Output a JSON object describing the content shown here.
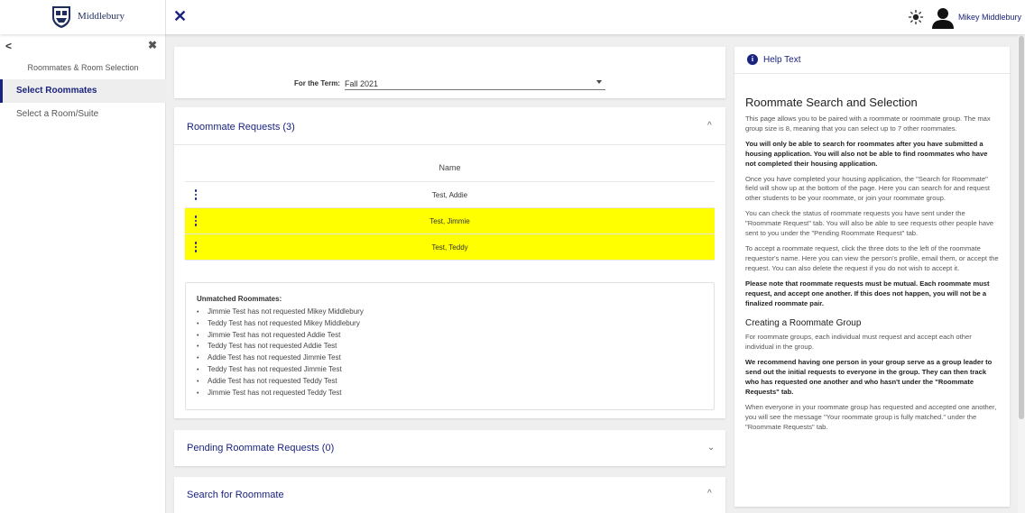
{
  "app": {
    "brand_name": "Middlebury",
    "user_name": "Mikey Middlebury"
  },
  "sidebar": {
    "heading": "Roommates & Room Selection",
    "items": [
      {
        "label": "Select Roommates",
        "active": true
      },
      {
        "label": "Select a Room/Suite",
        "active": false
      }
    ]
  },
  "term": {
    "label": "For the Term:",
    "value": "Fall 2021"
  },
  "roommate_requests": {
    "title": "Roommate Requests (3)",
    "column_header": "Name",
    "rows": [
      {
        "name": "Test, Addie",
        "highlighted": false
      },
      {
        "name": "Test, Jimmie",
        "highlighted": true
      },
      {
        "name": "Test, Teddy",
        "highlighted": true
      }
    ],
    "unmatched_title": "Unmatched Roommates:",
    "unmatched": [
      "Jimmie Test has not requested Mikey Middlebury",
      "Teddy Test has not requested Mikey Middlebury",
      "Jimmie Test has not requested Addie Test",
      "Teddy Test has not requested Addie Test",
      "Addie Test has not requested Jimmie Test",
      "Teddy Test has not requested Jimmie Test",
      "Addie Test has not requested Teddy Test",
      "Jimmie Test has not requested Teddy Test"
    ]
  },
  "pending": {
    "title": "Pending Roommate Requests (0)"
  },
  "search": {
    "title": "Search for Roommate"
  },
  "help": {
    "title": "Help Text",
    "heading": "Roommate Search and Selection",
    "p1": "This page allows you to be paired with a roommate or roommate group. The max group size is 8, meaning that you can select up to 7 other roommates.",
    "p2": "You will only be able to search for roommates after you have submitted a housing application. You will also not be able to find roommates who have not completed their housing application.",
    "p3": "Once you have completed your housing application, the \"Search for Roommate\" field will show up at the bottom of the page. Here you can search for and request other students to be your roommate, or join your roommate group.",
    "p4": "You can check the status of roommate requests you have sent under the \"Roommate Request\" tab. You will also be able to see requests other people have sent to you under the \"Pending Roommate Request\" tab.",
    "p5": "To accept a roommate request, click the three dots to the left of the roommate requestor's name. Here you can view the person's profile, email them, or accept the request. You can also delete the request if you do not wish to accept it.",
    "p6": "Please note that roommate requests must be mutual. Each roommate must request, and accept one another. If this does not happen, you will not be a finalized roommate pair.",
    "heading2": "Creating a Roommate Group",
    "p7": "For roommate groups, each individual must request and accept each other individual in the group.",
    "p8": "We recommend having one person in your group serve as a group leader to send out the initial requests to everyone in the group. They can then track who has requested one another and who hasn't under the \"Roommate Requests\" tab.",
    "p9": "When everyone in your roommate group has requested and accepted one another, you will see the message \"Your roommate group is fully matched.\" under the \"Roommate Requests\" tab."
  },
  "colors": {
    "accent": "#1a237e",
    "highlight": "#ffff00",
    "background": "#efefef"
  }
}
